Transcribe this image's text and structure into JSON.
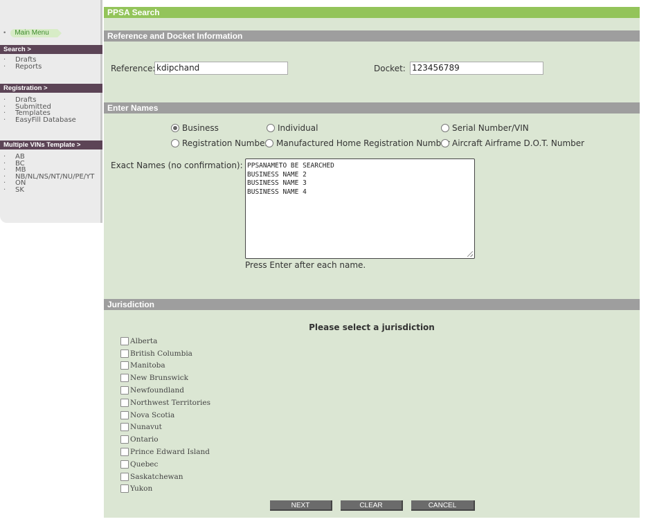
{
  "sidebar": {
    "main_menu": "Main Menu",
    "search_header": "Search >",
    "search_items": [
      "Drafts",
      "Reports"
    ],
    "registration_header": "Registration >",
    "registration_items": [
      "Drafts",
      "Submitted",
      "Templates",
      "EasyFill Database"
    ],
    "vin_header": "Multiple VINs Template >",
    "vin_items": [
      "AB",
      "BC",
      "MB",
      "NB/NL/NS/NT/NU/PE/YT",
      "ON",
      "SK"
    ]
  },
  "page": {
    "title": "PPSA Search"
  },
  "reference_section": {
    "header": "Reference and Docket Information",
    "reference_label": "Reference:",
    "reference_value": "kdipchand",
    "docket_label": "Docket:",
    "docket_value": "123456789"
  },
  "names_section": {
    "header": "Enter Names",
    "search_types": [
      {
        "label": "Business",
        "checked": true
      },
      {
        "label": "Individual",
        "checked": false
      },
      {
        "label": "Serial Number/VIN",
        "checked": false
      },
      {
        "label": "Registration Number",
        "checked": false
      },
      {
        "label": "Manufactured Home Registration Number",
        "checked": false
      },
      {
        "label": "Aircraft Airframe D.O.T. Number",
        "checked": false
      }
    ],
    "exact_names_label": "Exact Names (no confirmation):",
    "names": [
      "PPSANAMETO BE SEARCHED",
      "BUSINESS NAME 2",
      "BUSINESS NAME 3",
      "BUSINESS NAME 4"
    ],
    "hint": "Press Enter after each name."
  },
  "jurisdiction_section": {
    "header": "Jurisdiction",
    "prompt": "Please select a jurisdiction",
    "items": [
      "Alberta",
      "British Columbia",
      "Manitoba",
      "New Brunswick",
      "Newfoundland",
      "Northwest Territories",
      "Nova Scotia",
      "Nunavut",
      "Ontario",
      "Prince Edward Island",
      "Quebec",
      "Saskatchewan",
      "Yukon"
    ]
  },
  "buttons": {
    "next": "NEXT",
    "clear": "CLEAR",
    "cancel": "CANCEL"
  },
  "colors": {
    "title_bar": "#93c45a",
    "section_header": "#9e9e9e",
    "panel_background": "#dbe6d3",
    "sidebar_header": "#5c4456",
    "button": "#6b6b6b"
  }
}
